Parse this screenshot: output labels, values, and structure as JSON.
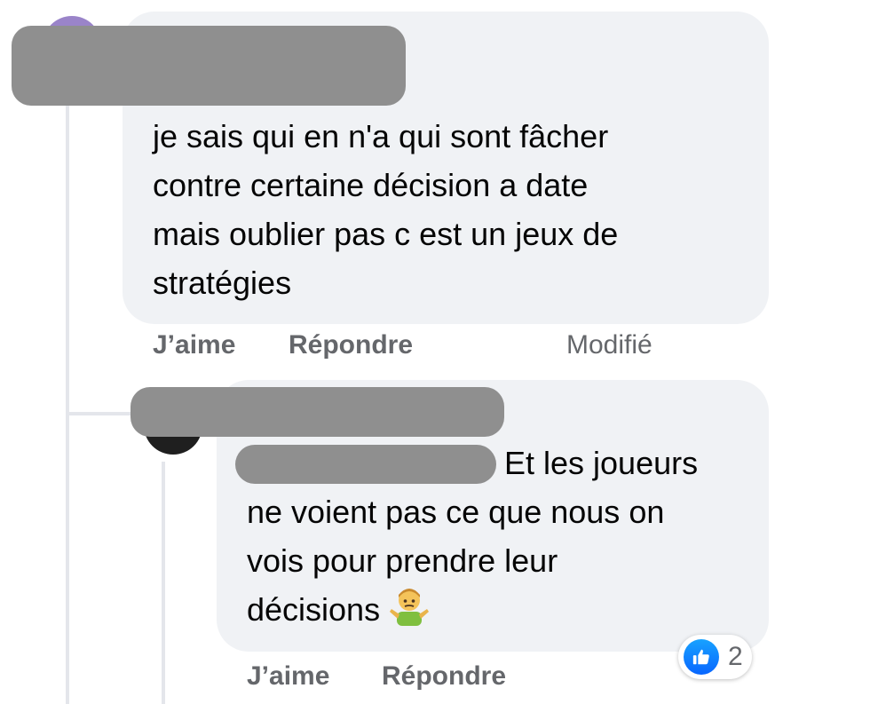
{
  "comment": {
    "text_lines": [
      "je sais qui en n'a qui sont fâcher",
      "contre certaine décision a date",
      "mais oublier pas c est un jeux de",
      "stratégies"
    ],
    "like_label": "J’aime",
    "reply_label": "Répondre",
    "edited_label": "Modifié"
  },
  "reply": {
    "text_lines": [
      "Et les joueurs",
      "ne voient pas ce que nous on",
      "vois pour prendre leur",
      "décisions"
    ],
    "emoji": "person-shrugging-emoji",
    "like_label": "J’aime",
    "reply_label": "Répondre",
    "reaction": {
      "icon": "thumbs-up-icon",
      "count": "2"
    }
  },
  "colors": {
    "bubble": "#f0f2f5",
    "action_text": "#65676b",
    "like_blue": "#0866ff",
    "redaction": "#8f8f8f"
  }
}
